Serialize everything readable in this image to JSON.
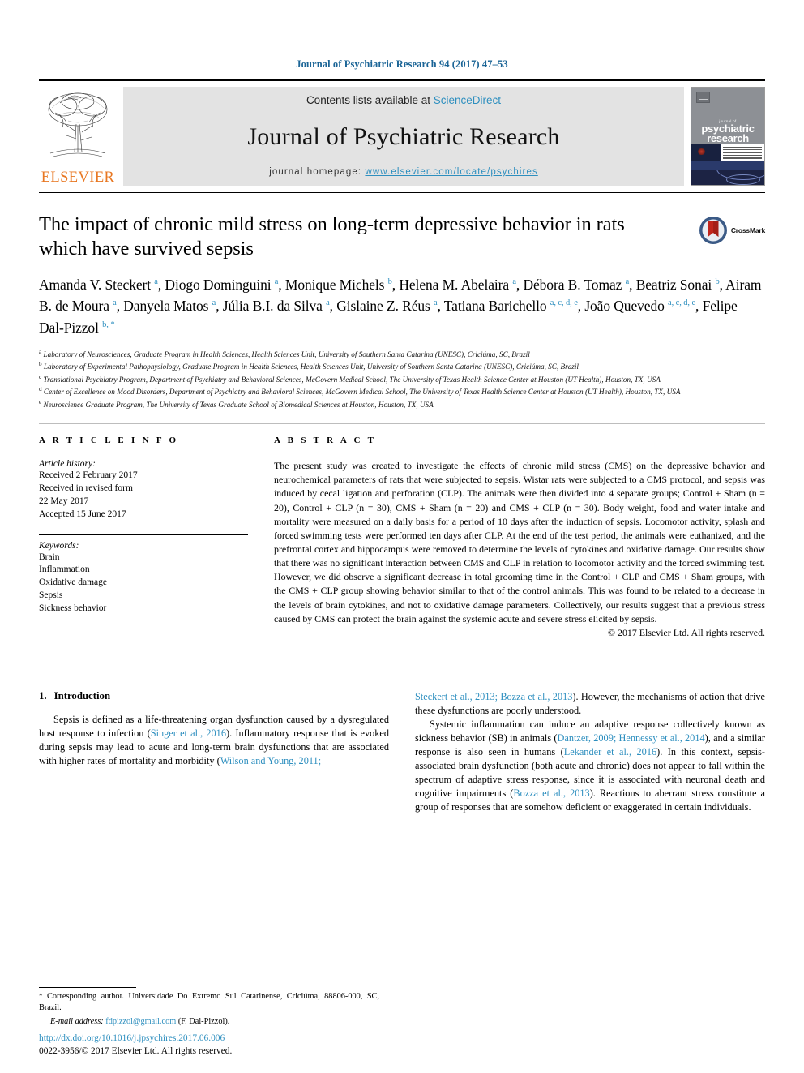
{
  "running_head": "Journal of Psychiatric Research 94 (2017) 47–53",
  "masthead": {
    "contents_prefix": "Contents lists available at ",
    "sciencedirect": "ScienceDirect",
    "journal_name": "Journal of Psychiatric Research",
    "homepage_prefix": "journal homepage: ",
    "homepage_url": "www.elsevier.com/locate/psychires",
    "publisher_logo_text": "ELSEVIER",
    "cover_title_small": "journal of",
    "cover_title_line1": "psychiatric",
    "cover_title_line2": "research"
  },
  "article": {
    "title": "The impact of chronic mild stress on long-term depressive behavior in rats which have survived sepsis",
    "crossmark_label": "CrossMark",
    "authors_html": "Amanda V. Steckert <sup>a</sup>, Diogo Dominguini <sup>a</sup>, Monique Michels <sup>b</sup>, Helena M. Abelaira <sup>a</sup>, Débora B. Tomaz <sup>a</sup>, Beatriz Sonai <sup>b</sup>, Airam B. de Moura <sup>a</sup>, Danyela Matos <sup>a</sup>, Júlia B.I. da Silva <sup>a</sup>, Gislaine Z. Réus <sup>a</sup>, Tatiana Barichello <sup>a, c, d, e</sup>, João Quevedo <sup>a, c, d, e</sup>, Felipe Dal-Pizzol <sup>b, *</sup>",
    "affiliations": [
      {
        "marker": "a",
        "text": "Laboratory of Neurosciences, Graduate Program in Health Sciences, Health Sciences Unit, University of Southern Santa Catarina (UNESC), Criciúma, SC, Brazil"
      },
      {
        "marker": "b",
        "text": "Laboratory of Experimental Pathophysiology, Graduate Program in Health Sciences, Health Sciences Unit, University of Southern Santa Catarina (UNESC), Criciúma, SC, Brazil"
      },
      {
        "marker": "c",
        "text": "Translational Psychiatry Program, Department of Psychiatry and Behavioral Sciences, McGovern Medical School, The University of Texas Health Science Center at Houston (UT Health), Houston, TX, USA"
      },
      {
        "marker": "d",
        "text": "Center of Excellence on Mood Disorders, Department of Psychiatry and Behavioral Sciences, McGovern Medical School, The University of Texas Health Science Center at Houston (UT Health), Houston, TX, USA"
      },
      {
        "marker": "e",
        "text": "Neuroscience Graduate Program, The University of Texas Graduate School of Biomedical Sciences at Houston, Houston, TX, USA"
      }
    ]
  },
  "article_info": {
    "heading": "A R T I C L E  I N F O",
    "history_label": "Article history:",
    "history_lines": [
      "Received 2 February 2017",
      "Received in revised form",
      "22 May 2017",
      "Accepted 15 June 2017"
    ],
    "keywords_label": "Keywords:",
    "keywords": [
      "Brain",
      "Inflammation",
      "Oxidative damage",
      "Sepsis",
      "Sickness behavior"
    ]
  },
  "abstract": {
    "heading": "A B S T R A C T",
    "text": "The present study was created to investigate the effects of chronic mild stress (CMS) on the depressive behavior and neurochemical parameters of rats that were subjected to sepsis. Wistar rats were subjected to a CMS protocol, and sepsis was induced by cecal ligation and perforation (CLP). The animals were then divided into 4 separate groups; Control + Sham (n = 20), Control + CLP (n = 30), CMS + Sham (n = 20) and CMS + CLP (n = 30). Body weight, food and water intake and mortality were measured on a daily basis for a period of 10 days after the induction of sepsis. Locomotor activity, splash and forced swimming tests were performed ten days after CLP. At the end of the test period, the animals were euthanized, and the prefrontal cortex and hippocampus were removed to determine the levels of cytokines and oxidative damage. Our results show that there was no significant interaction between CMS and CLP in relation to locomotor activity and the forced swimming test. However, we did observe a significant decrease in total grooming time in the Control + CLP and CMS + Sham groups, with the CMS + CLP group showing behavior similar to that of the control animals. This was found to be related to a decrease in the levels of brain cytokines, and not to oxidative damage parameters. Collectively, our results suggest that a previous stress caused by CMS can protect the brain against the systemic acute and severe stress elicited by sepsis.",
    "copyright": "© 2017 Elsevier Ltd. All rights reserved."
  },
  "body": {
    "section_number": "1.",
    "section_title": "Introduction",
    "left_paragraph_html": "Sepsis is defined as a life-threatening organ dysfunction caused by a dysregulated host response to infection (<a class=\"ref\" href=\"#\">Singer et al., 2016</a>). Inflammatory response that is evoked during sepsis may lead to acute and long-term brain dysfunctions that are associated with higher rates of mortality and morbidity (<a class=\"ref\" href=\"#\">Wilson and Young, 2011;</a>",
    "right_paragraph1_html": "<a class=\"ref\" href=\"#\">Steckert et al., 2013; Bozza et al., 2013</a>). However, the mechanisms of action that drive these dysfunctions are poorly understood.",
    "right_paragraph2_html": "Systemic inflammation can induce an adaptive response collectively known as sickness behavior (SB) in animals (<a class=\"ref\" href=\"#\">Dantzer, 2009; Hennessy et al., 2014</a>), and a similar response is also seen in humans (<a class=\"ref\" href=\"#\">Lekander et al., 2016</a>). In this context, sepsis-associated brain dysfunction (both acute and chronic) does not appear to fall within the spectrum of adaptive stress response, since it is associated with neuronal death and cognitive impairments (<a class=\"ref\" href=\"#\">Bozza et al., 2013</a>). Reactions to aberrant stress constitute a group of responses that are somehow deficient or exaggerated in certain individuals."
  },
  "footnotes": {
    "corresponding_star": "*",
    "corresponding_text": "Corresponding author. Universidade Do Extremo Sul Catarinense, Criciúma, 88806-000, SC, Brazil.",
    "email_label": "E-mail address:",
    "email": "fdpizzol@gmail.com",
    "email_owner": "(F. Dal-Pizzol).",
    "doi_url": "http://dx.doi.org/10.1016/j.jpsychires.2017.06.006",
    "issn_line": "0022-3956/© 2017 Elsevier Ltd. All rights reserved."
  },
  "colors": {
    "link": "#2e8fbf",
    "elsevier_orange": "#E87722",
    "band_grey": "#e3e3e3"
  }
}
